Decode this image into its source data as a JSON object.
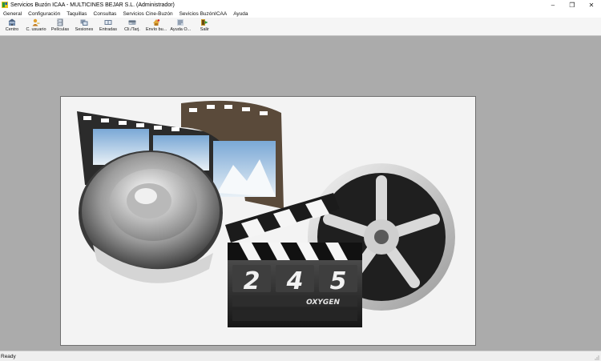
{
  "window": {
    "title": "Servicios Buzón ICAA - MULTICINES BEJAR S.L. (Administrador)",
    "controls": {
      "minimize": "–",
      "restore": "❐",
      "close": "✕"
    }
  },
  "menu": {
    "items": [
      {
        "label": "General"
      },
      {
        "label": "Configuración"
      },
      {
        "label": "Taquillas"
      },
      {
        "label": "Consultas"
      },
      {
        "label": "Servicios Cine-Buzón"
      },
      {
        "label": "Sevicios BuzónICAA"
      },
      {
        "label": "Ayuda"
      }
    ]
  },
  "toolbar": {
    "buttons": [
      {
        "label": "Centro",
        "icon": "building-icon"
      },
      {
        "label": "C. usuario",
        "icon": "user-key-icon"
      },
      {
        "label": "Películas",
        "icon": "film-icon"
      },
      {
        "label": "Sesiones",
        "icon": "sessions-icon"
      },
      {
        "label": "Entradas",
        "icon": "tickets-icon"
      },
      {
        "label": "Cli./Tarj.",
        "icon": "card-icon"
      },
      {
        "label": "Envío bu...",
        "icon": "send-icon"
      },
      {
        "label": "Ayuda O...",
        "icon": "help-icon"
      },
      {
        "label": "Salir",
        "icon": "exit-icon"
      }
    ]
  },
  "splash": {
    "clapper_numbers": [
      "2",
      "4",
      "5"
    ],
    "clapper_brand": "OXYGEN"
  },
  "status": {
    "text": "Ready"
  }
}
